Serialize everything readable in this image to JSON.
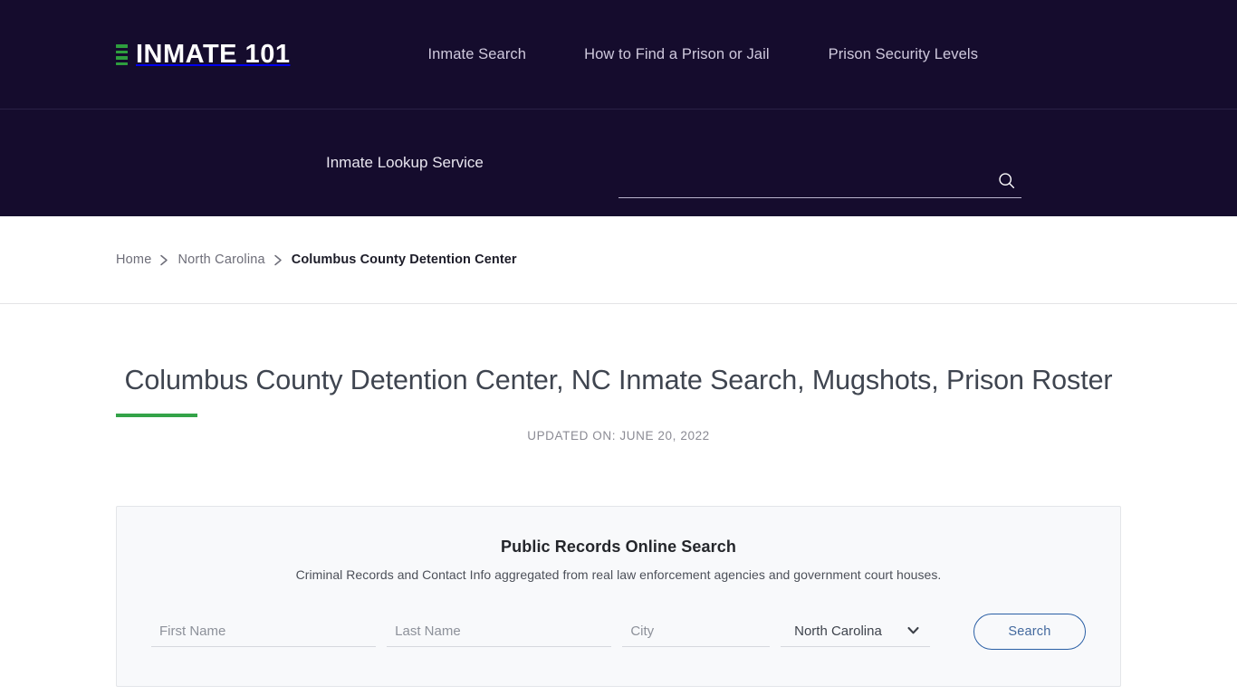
{
  "header": {
    "logo_text": "INMATE 101",
    "logo_icon": "bars-icon",
    "nav": [
      {
        "label": "Inmate Search"
      },
      {
        "label": "How to Find a Prison or Jail"
      },
      {
        "label": "Prison Security Levels"
      }
    ]
  },
  "search_strip": {
    "label": "Inmate Lookup Service",
    "input_value": "",
    "input_placeholder": "",
    "icon": "search-icon"
  },
  "breadcrumb": {
    "items": [
      {
        "label": "Home",
        "current": false
      },
      {
        "label": "North Carolina",
        "current": false
      },
      {
        "label": "Columbus County Detention Center",
        "current": true
      }
    ],
    "separator": "chevron-right-icon"
  },
  "main": {
    "title": "Columbus County Detention Center, NC Inmate Search, Mugshots, Prison Roster",
    "updated": "UPDATED ON: JUNE 20, 2022"
  },
  "panel": {
    "title": "Public Records Online Search",
    "subtitle": "Criminal Records and Contact Info aggregated from real law enforcement agencies and government court houses.",
    "form": {
      "first_name": {
        "placeholder": "First Name",
        "value": ""
      },
      "last_name": {
        "placeholder": "Last Name",
        "value": ""
      },
      "city": {
        "placeholder": "City",
        "value": ""
      },
      "state": {
        "selected": "North Carolina",
        "options": [
          "North Carolina"
        ]
      },
      "submit_label": "Search"
    }
  },
  "colors": {
    "header_bg": "#150C2D",
    "accent_green": "#33A348",
    "panel_bg": "#F8F9FB",
    "button_blue": "#2A5FA5"
  }
}
